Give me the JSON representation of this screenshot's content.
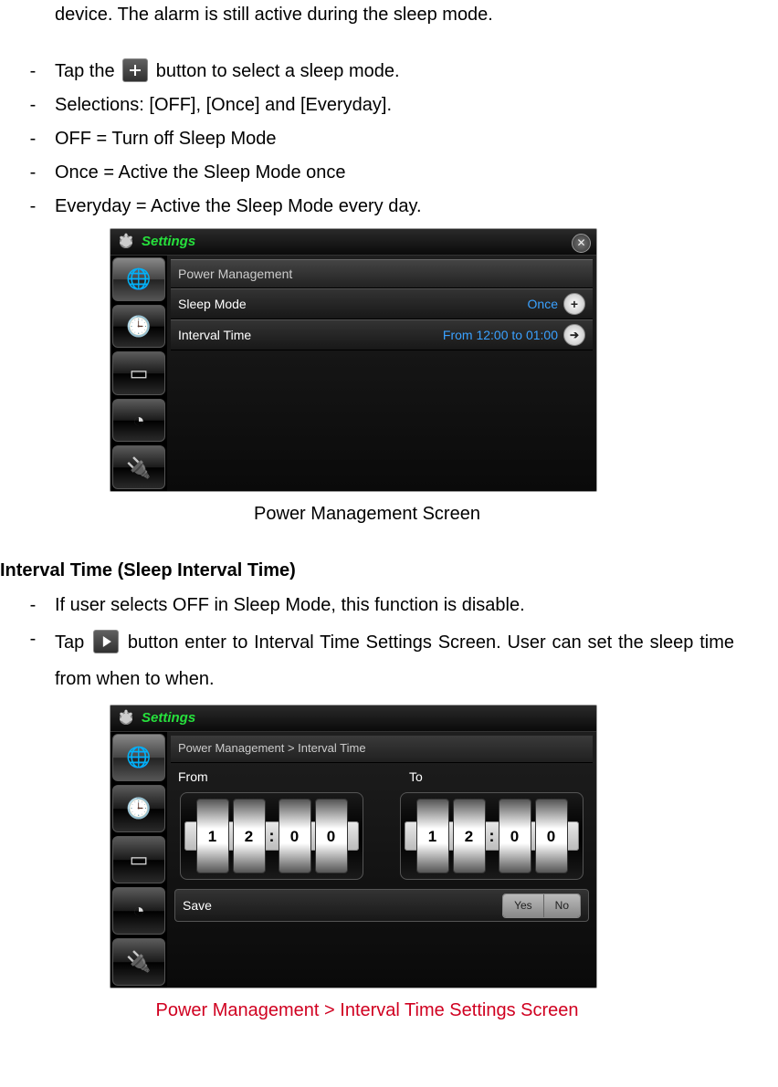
{
  "intro_fragment": "device. The alarm is still active during the sleep mode.",
  "bullets1": [
    {
      "pre": "Tap the ",
      "post": " button to select a sleep mode.",
      "icon": "plus"
    },
    {
      "text": "Selections: [OFF], [Once] and [Everyday]."
    },
    {
      "text": "OFF = Turn off Sleep Mode"
    },
    {
      "text": "Once = Active the Sleep Mode once"
    },
    {
      "text": "Everyday = Active the Sleep Mode every day."
    }
  ],
  "screenshot1": {
    "title": "Settings",
    "section": "Power Management",
    "rows": [
      {
        "label": "Sleep Mode",
        "value": "Once",
        "btn": "plus"
      },
      {
        "label": "Interval Time",
        "value": "From 12:00 to 01:00",
        "btn": "arrow"
      }
    ],
    "caption": "Power Management Screen"
  },
  "section2_title": "Interval Time (Sleep Interval Time)",
  "bullets2": [
    {
      "text": "If user selects OFF in Sleep Mode, this function is disable."
    },
    {
      "pre": "Tap ",
      "post": " button enter to Interval Time Settings Screen. User can set the sleep time from when to when.",
      "icon": "arrow"
    }
  ],
  "screenshot2": {
    "title": "Settings",
    "breadcrumb": "Power Management > Interval Time",
    "from_label": "From",
    "to_label": "To",
    "from_time": [
      "1",
      "2",
      "0",
      "0"
    ],
    "to_time": [
      "1",
      "2",
      "0",
      "0"
    ],
    "save_label": "Save",
    "yes": "Yes",
    "no": "No",
    "caption": "Power Management > Interval Time Settings Screen"
  }
}
